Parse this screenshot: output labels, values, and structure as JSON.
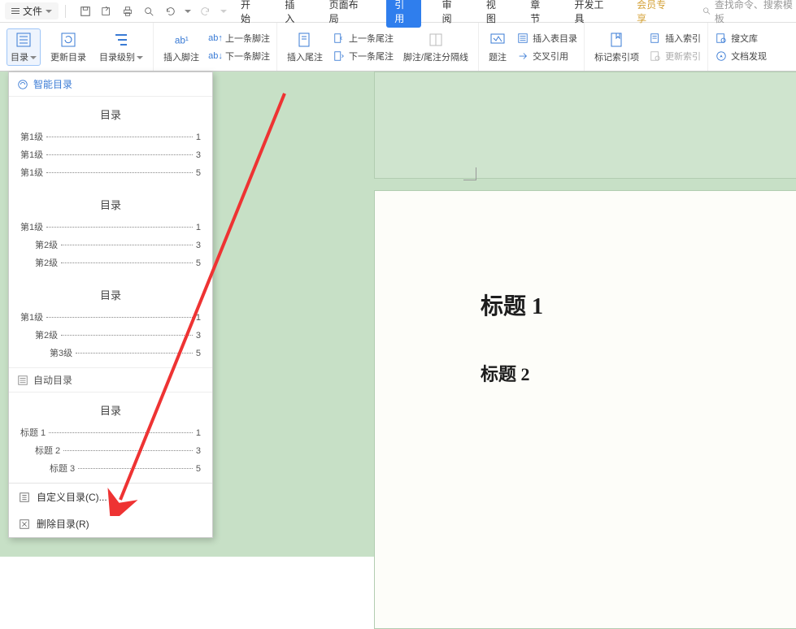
{
  "topbar": {
    "file_label": "文件"
  },
  "tabs": {
    "start": "开始",
    "insert": "插入",
    "layout": "页面布局",
    "reference": "引用",
    "review": "审阅",
    "view": "视图",
    "chapter": "章节",
    "devtools": "开发工具",
    "vip": "会员专享",
    "search_placeholder": "查找命令、搜索模板"
  },
  "ribbon": {
    "toc": "目录",
    "update_toc": "更新目录",
    "toc_level": "目录级别",
    "insert_footnote": "插入脚注",
    "prev_footnote": "上一条脚注",
    "next_footnote": "下一条脚注",
    "insert_endnote": "插入尾注",
    "prev_endnote": "上一条尾注",
    "next_endnote": "下一条尾注",
    "separator": "脚注/尾注分隔线",
    "caption": "题注",
    "insert_fig_toc": "插入表目录",
    "cross_ref": "交叉引用",
    "mark_index": "标记索引项",
    "insert_index": "插入索引",
    "update_index": "更新索引",
    "search_lib": "搜文库",
    "doc_discover": "文档发现"
  },
  "dropdown": {
    "smart_toc": "智能目录",
    "auto_toc": "自动目录",
    "toc_title": "目录",
    "lvl1": "第1级",
    "lvl2": "第2级",
    "lvl3": "第3级",
    "heading1": "标题 1",
    "heading2": "标题 2",
    "heading3": "标题 3",
    "p1": "1",
    "p3": "3",
    "p5": "5",
    "custom_toc": "自定义目录(C)...",
    "delete_toc": "删除目录(R)"
  },
  "document": {
    "h1": "标题 1",
    "h2": "标题 2"
  }
}
